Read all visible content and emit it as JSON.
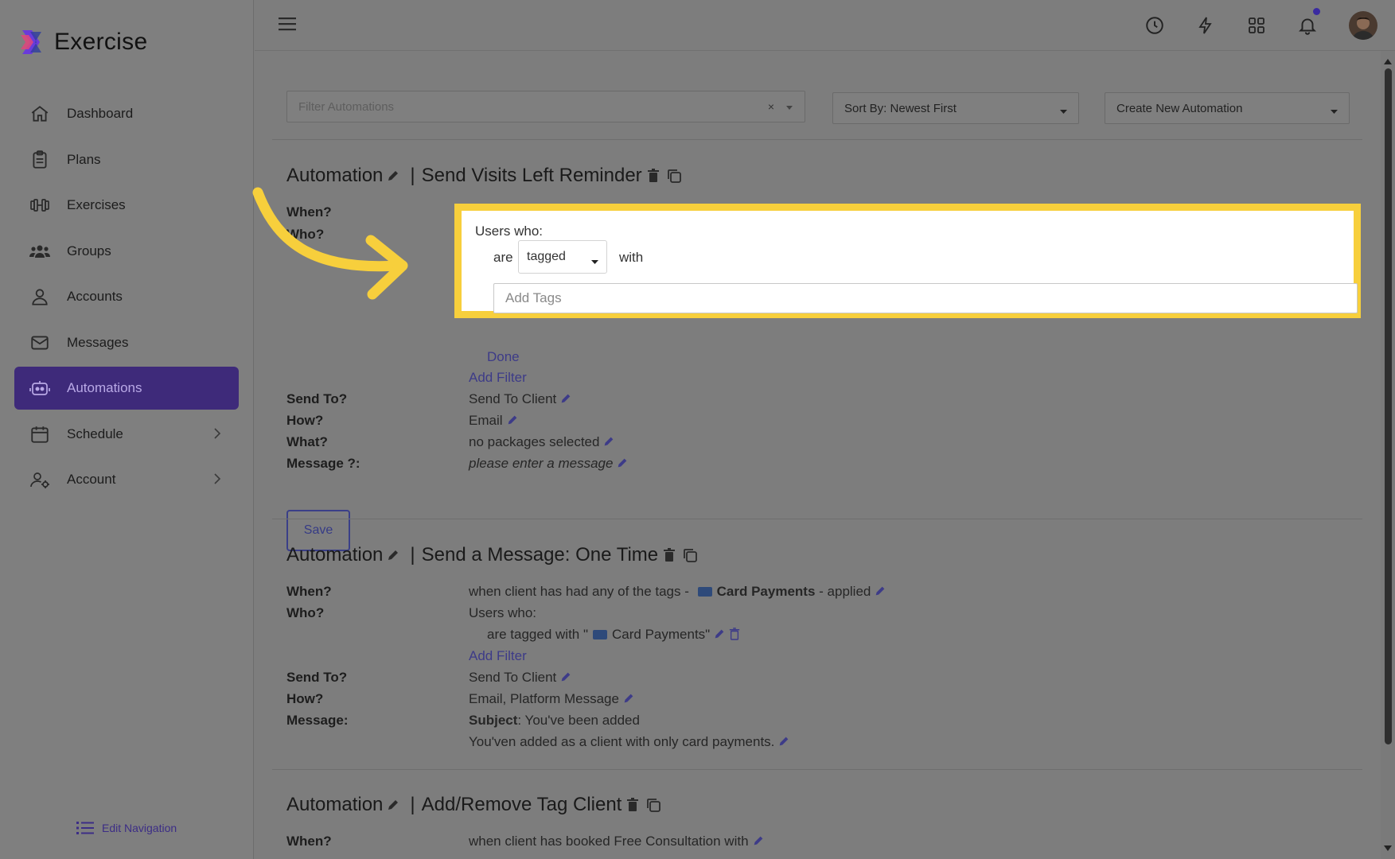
{
  "brand": {
    "name": "Exercise"
  },
  "sidebar": {
    "items": [
      {
        "label": "Dashboard",
        "icon": "home-icon"
      },
      {
        "label": "Plans",
        "icon": "clipboard-icon"
      },
      {
        "label": "Exercises",
        "icon": "dumbbell-icon"
      },
      {
        "label": "Groups",
        "icon": "users-icon"
      },
      {
        "label": "Accounts",
        "icon": "user-icon"
      },
      {
        "label": "Messages",
        "icon": "mail-icon"
      },
      {
        "label": "Automations",
        "icon": "robot-icon",
        "active": true
      },
      {
        "label": "Schedule",
        "icon": "calendar-icon",
        "expandable": true
      },
      {
        "label": "Account",
        "icon": "user-cog-icon",
        "expandable": true
      }
    ],
    "edit_nav": "Edit Navigation"
  },
  "toolbar": {
    "filter_placeholder": "Filter Automations",
    "sort": "Sort By: Newest First",
    "create": "Create New Automation"
  },
  "automations": [
    {
      "prefix": "Automation",
      "name": "Send Visits Left Reminder",
      "when_label": "When?",
      "who_label": "Who?",
      "done_hidden": "Done",
      "add_filter": "Add Filter",
      "send_to_label": "Send To?",
      "send_to": "Send To Client",
      "how_label": "How?",
      "how": "Email",
      "what_label": "What?",
      "what": "no packages selected",
      "message_label": "Message ?:",
      "message": "please enter a message",
      "save": "Save"
    },
    {
      "prefix": "Automation",
      "name": "Send a Message: One Time",
      "when_label": "When?",
      "when_prefix": "when client has had any of the tags -",
      "when_tag": "Card Payments",
      "when_suffix": "- applied",
      "who_label": "Who?",
      "who": "Users who:",
      "who_rule_prefix": "are tagged with \"",
      "who_rule_tag": "Card Payments\"",
      "add_filter": "Add Filter",
      "send_to_label": "Send To?",
      "send_to": "Send To Client",
      "how_label": "How?",
      "how": "Email, Platform Message",
      "message_label": "Message:",
      "subject_label": "Subject",
      "subject": ": You've been added",
      "body": "You'ven added as a client with only card payments."
    },
    {
      "prefix": "Automation",
      "name": "Add/Remove Tag Client",
      "when_label": "When?",
      "when": "when client has booked Free Consultation with"
    }
  ],
  "popover": {
    "who": "Users who:",
    "are": "are",
    "select_value": "tagged",
    "with": "with",
    "tags_placeholder": "Add Tags"
  },
  "colors": {
    "highlight": "#f7cf3c",
    "active_nav": "#3e2a7a",
    "accent": "#3d3b88"
  }
}
